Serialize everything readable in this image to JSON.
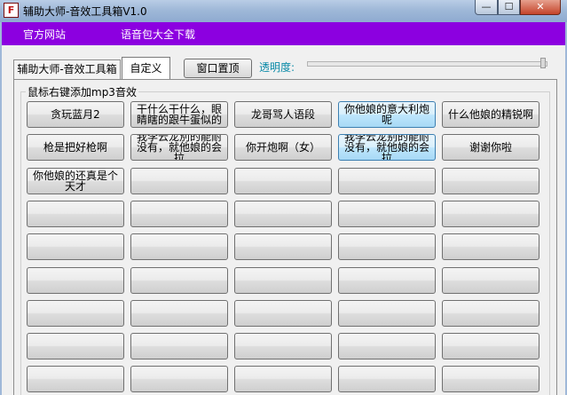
{
  "window": {
    "title": "辅助大师-音效工具箱V1.0",
    "icon_text": "F",
    "controls": {
      "minimize": "—",
      "maximize": "☐",
      "close": "✕"
    }
  },
  "menu": {
    "official_site": "官方网站",
    "voice_pack": "语音包大全下载"
  },
  "tabs": [
    "辅助大师-音效工具箱",
    "自定义"
  ],
  "toolbar": {
    "pin_label": "窗口置顶",
    "opacity_label": "透明度:",
    "opacity_value": 1.0
  },
  "group_label": "鼠标右键添加mp3音效",
  "colors": {
    "menu_bg": "#8c00e0",
    "opacity_label": "#0a8aa8",
    "highlight": "#bee6fd"
  },
  "sound_buttons": [
    [
      "贪玩蓝月2",
      "干什么干什么，眼睛瞎的跟牛蛋似的",
      "龙哥骂人语段",
      "你他娘的意大利炮呢",
      "什么他娘的精锐啊"
    ],
    [
      "枪是把好枪啊",
      "我李云龙別的能耐没有，就他娘的会拉",
      "你开炮啊（女）",
      "我李云龙别的能耐没有，就他娘的会拉",
      "谢谢你啦"
    ],
    [
      "你他娘的还真是个天才",
      "",
      "",
      "",
      ""
    ],
    [
      "",
      "",
      "",
      "",
      ""
    ],
    [
      "",
      "",
      "",
      "",
      ""
    ],
    [
      "",
      "",
      "",
      "",
      ""
    ],
    [
      "",
      "",
      "",
      "",
      ""
    ],
    [
      "",
      "",
      "",
      "",
      ""
    ],
    [
      "",
      "",
      "",
      "",
      ""
    ]
  ],
  "highlighted": [
    [
      0,
      3
    ],
    [
      1,
      3
    ]
  ]
}
